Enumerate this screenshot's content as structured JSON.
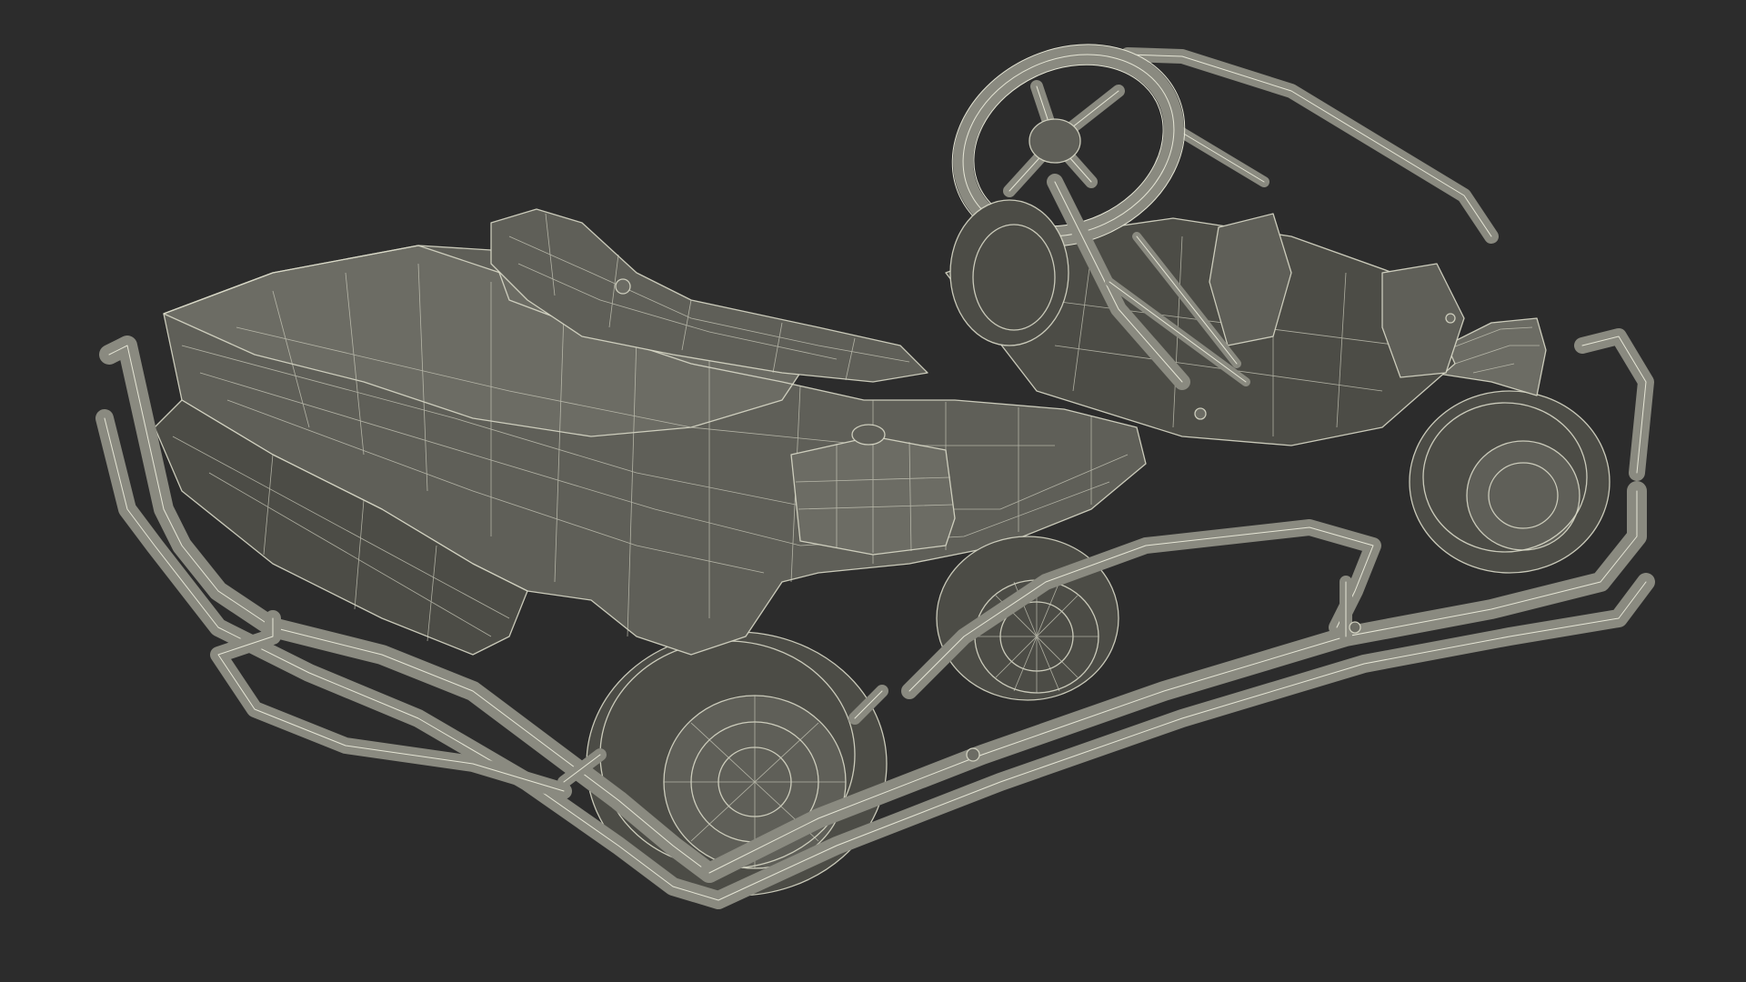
{
  "scene": {
    "background_color": "#2c2c2c",
    "model_base_color": "#5f5f58",
    "wire_color": "#d9d9c8"
  }
}
